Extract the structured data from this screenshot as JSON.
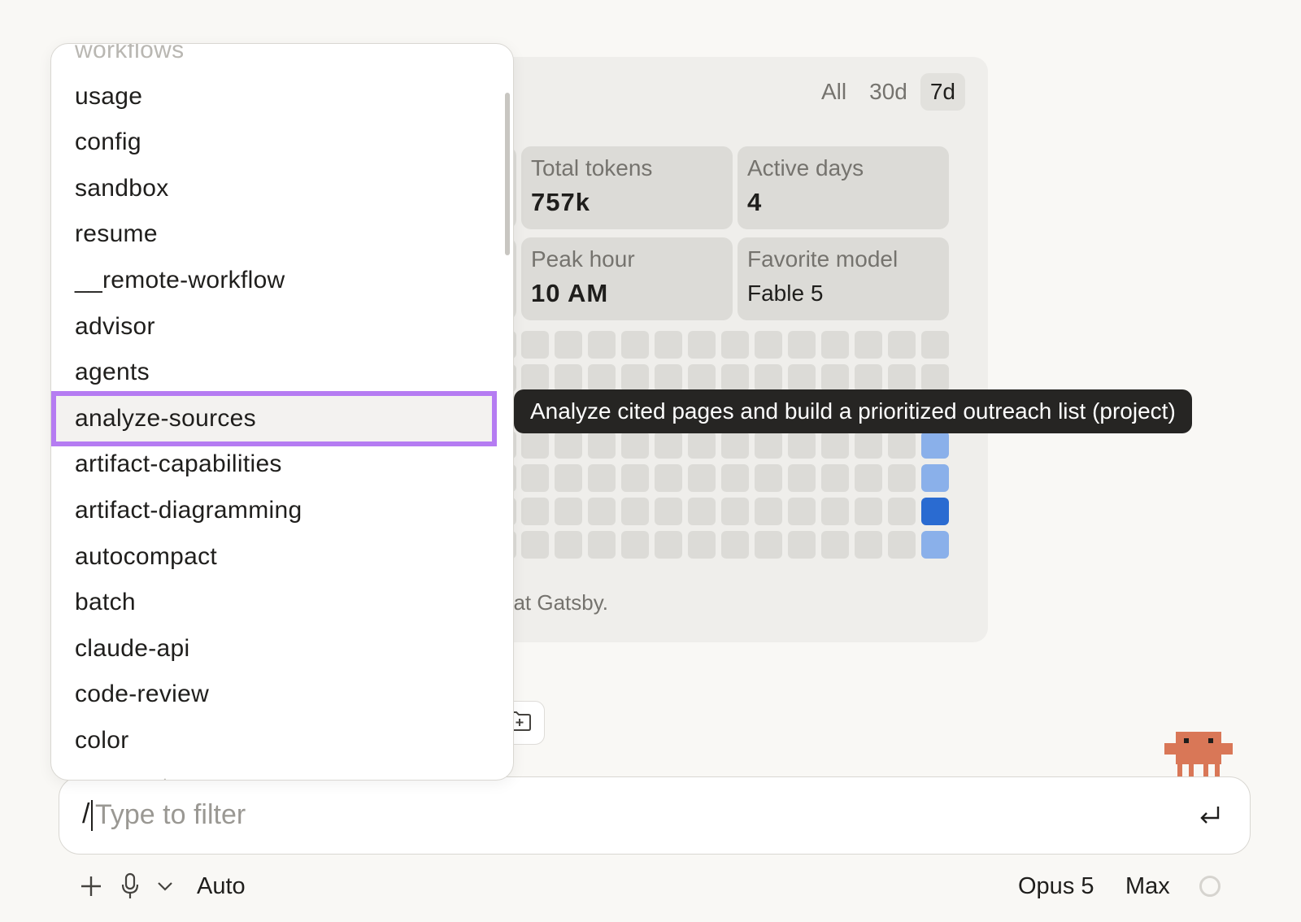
{
  "stats_panel": {
    "range_tabs": [
      {
        "label": "All",
        "active": false
      },
      {
        "label": "30d",
        "active": false
      },
      {
        "label": "7d",
        "active": true
      }
    ],
    "cards": {
      "total_tokens": {
        "label": "Total tokens",
        "value": "757k"
      },
      "active_days": {
        "label": "Active days",
        "value": "4"
      },
      "peak_hour": {
        "label": "Peak hour",
        "value": "10 AM"
      },
      "favorite_model": {
        "label": "Favorite model",
        "value": "Fable 5"
      }
    },
    "footer_text": "eat Gatsby.",
    "heatmap_colors": {
      "empty": "#dcdbd7",
      "light": "#8ab0ea",
      "dark": "#2a6bd1"
    }
  },
  "dropdown": {
    "top_partial": "workflows",
    "items": [
      "usage",
      "config",
      "sandbox",
      "resume",
      "__remote-workflow",
      "advisor",
      "agents",
      "analyze-sources",
      "artifact-capabilities",
      "artifact-diagramming",
      "autocompact",
      "batch",
      "claude-api",
      "code-review",
      "color"
    ],
    "bottom_partial": "compact",
    "selected": "analyze-sources",
    "highlight_color": "#b57cf2"
  },
  "tooltip": {
    "text": "Analyze cited pages and build a prioritized outreach list (project)"
  },
  "input": {
    "prefix": "/",
    "value": "",
    "placeholder": "Type to filter"
  },
  "toolbar": {
    "add_icon": "plus-icon",
    "mic_icon": "microphone-icon",
    "chevron_icon": "chevron-down-icon",
    "mode_label": "Auto",
    "model_label": "Opus 5",
    "effort_label": "Max",
    "status_icon": "circle-icon"
  },
  "mascot_color": "#d97757"
}
